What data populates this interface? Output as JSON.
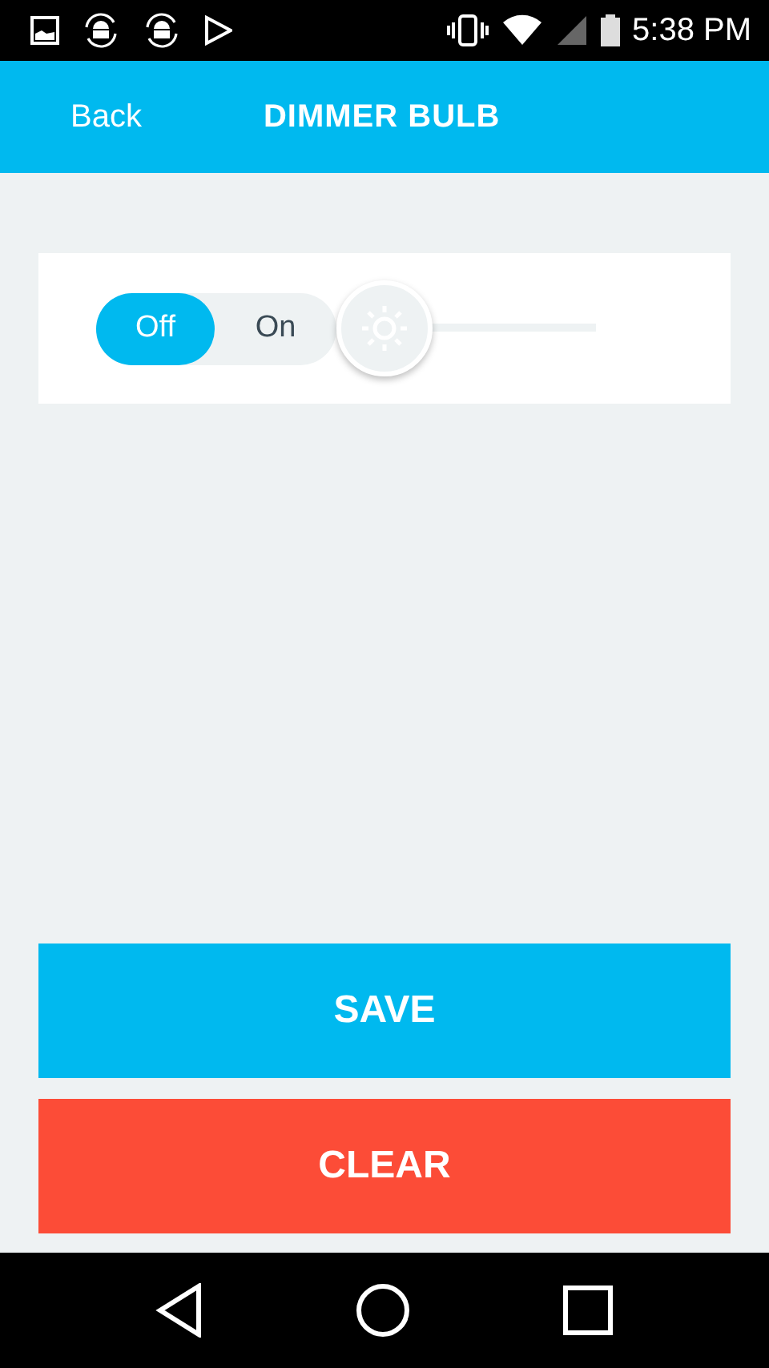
{
  "status_bar": {
    "time": "5:38 PM"
  },
  "header": {
    "back": "Back",
    "title": "DIMMER BULB"
  },
  "power_toggle": [
    {
      "label": "Off",
      "selected": true
    },
    {
      "label": "On",
      "selected": false
    }
  ],
  "brightness": {
    "level": 0
  },
  "buttons": [
    {
      "label": "SAVE",
      "kind": "save"
    },
    {
      "label": "CLEAR",
      "kind": "clear"
    }
  ]
}
